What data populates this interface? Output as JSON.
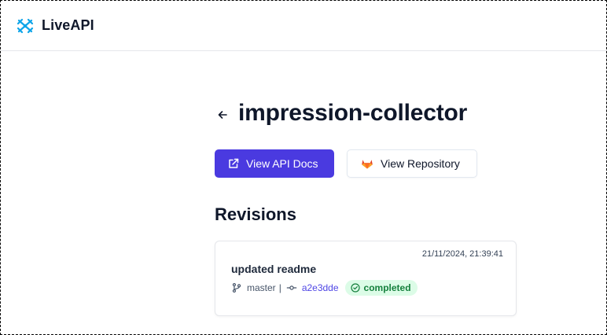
{
  "app": {
    "name": "LiveAPI",
    "logo_icon": "liveapi-logo-icon",
    "logo_color": "#0ea5e9"
  },
  "page": {
    "title": "impression-collector",
    "back_icon": "arrow-left-icon"
  },
  "actions": {
    "api_docs": {
      "label": "View API Docs",
      "icon": "external-link-icon",
      "color": "#4a3ae0"
    },
    "repository": {
      "label": "View Repository",
      "icon": "gitlab-icon",
      "icon_color": "#e24329"
    }
  },
  "revisions": {
    "heading": "Revisions",
    "items": [
      {
        "message": "updated readme",
        "timestamp": "21/11/2024, 21:39:41",
        "branch": "master",
        "separator": "|",
        "commit": "a2e3dde",
        "status": "completed",
        "status_color": "#15803d",
        "status_bg": "#dcfce7"
      }
    ]
  }
}
